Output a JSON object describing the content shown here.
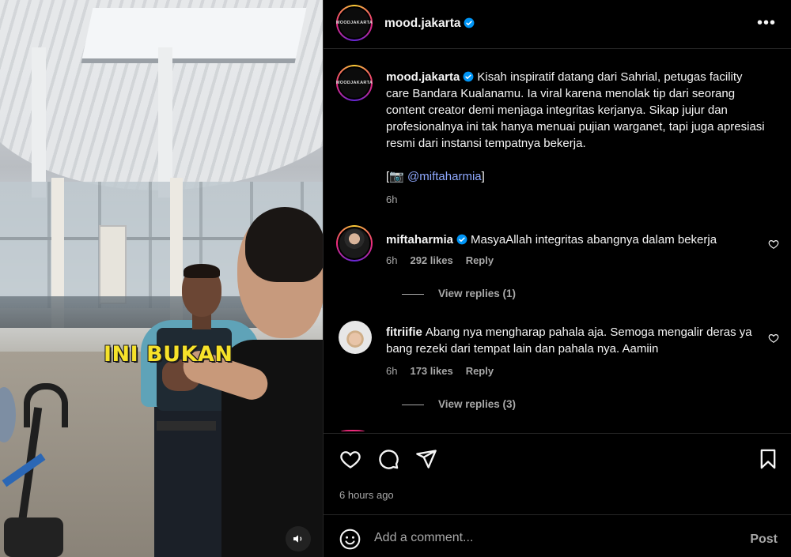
{
  "video": {
    "caption": "INI BUKAN",
    "sound_icon": "speaker-icon"
  },
  "post": {
    "username": "mood.jakarta",
    "avatar_text": "MOODJAKARTA",
    "more_label": "•••",
    "caption_text": "Kisah inspiratif datang dari Sahrial, petugas facility care Bandara Kualanamu. Ia viral karena menolak tip dari seorang content creator demi menjaga integritas kerjanya. Sikap jujur dan profesionalnya ini tak hanya menuai pujian warganet, tapi juga apresiasi resmi dari instansi tempatnya bekerja.",
    "credit_open": "[📷",
    "credit_mention": "@miftaharmia",
    "credit_close": "]",
    "caption_age": "6h"
  },
  "comments": [
    {
      "username": "miftaharmia",
      "verified": true,
      "text": "MasyaAllah integritas abangnya dalam bekerja",
      "age": "6h",
      "likes": "292 likes",
      "reply_label": "Reply",
      "view_replies": "View replies (1)"
    },
    {
      "username": "fitriifie",
      "verified": false,
      "text": "Abang nya mengharap pahala aja. Semoga mengalir deras ya bang rezeki dari tempat lain dan pahala nya. Aamiin",
      "age": "6h",
      "likes": "173 likes",
      "reply_label": "Reply",
      "view_replies": "View replies (3)"
    }
  ],
  "actions": {
    "like_icon": "heart-icon",
    "comment_icon": "comment-icon",
    "share_icon": "share-icon",
    "save_icon": "bookmark-icon",
    "time_ago": "6 hours ago"
  },
  "composer": {
    "placeholder": "Add a comment...",
    "post_label": "Post"
  },
  "colors": {
    "background": "#000000",
    "text": "#f5f5f5",
    "muted": "#a8a8a8",
    "mention": "#8fa9ff",
    "verified": "#0095f6",
    "caption_yellow": "#f6e22a"
  }
}
